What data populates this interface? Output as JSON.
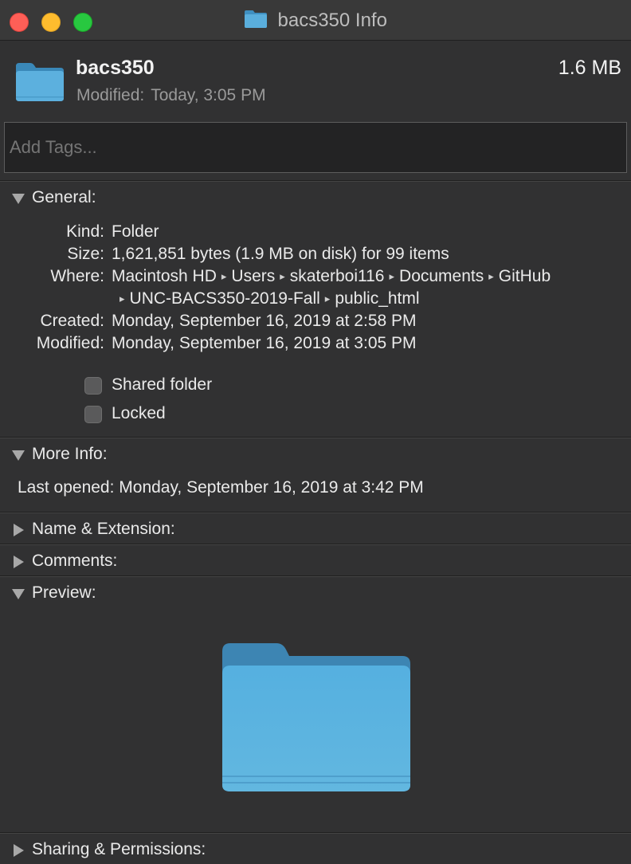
{
  "window": {
    "title": "bacs350 Info",
    "colors": {
      "close": "#fe5f57",
      "minimize": "#febc2e",
      "zoom": "#28c840",
      "folder": "#5aaedc"
    }
  },
  "header": {
    "name": "bacs350",
    "size": "1.6 MB",
    "modified_label": "Modified:",
    "modified_value": "Today, 3:05 PM",
    "icon": "folder-icon"
  },
  "tags": {
    "placeholder": "Add Tags...",
    "value": ""
  },
  "general": {
    "title": "General:",
    "kind_label": "Kind:",
    "kind_value": "Folder",
    "size_label": "Size:",
    "size_value": "1,621,851 bytes (1.9 MB on disk) for 99 items",
    "where_label": "Where:",
    "where_path": [
      "Macintosh HD",
      "Users",
      "skaterboi116",
      "Documents",
      "GitHub",
      "UNC-BACS350-2019-Fall",
      "public_html"
    ],
    "path_separator": "▸",
    "created_label": "Created:",
    "created_value": "Monday, September 16, 2019 at 2:58 PM",
    "modified_label": "Modified:",
    "modified_value": "Monday, September 16, 2019 at 3:05 PM",
    "shared_folder_label": "Shared folder",
    "shared_folder_checked": false,
    "locked_label": "Locked",
    "locked_checked": false
  },
  "more_info": {
    "title": "More Info:",
    "last_opened_label": "Last opened:",
    "last_opened_value": "Monday, September 16, 2019 at 3:42 PM"
  },
  "name_extension": {
    "title": "Name & Extension:",
    "expanded": false
  },
  "comments": {
    "title": "Comments:",
    "expanded": false
  },
  "preview": {
    "title": "Preview:",
    "expanded": true
  },
  "sharing": {
    "title": "Sharing & Permissions:",
    "expanded": false
  }
}
